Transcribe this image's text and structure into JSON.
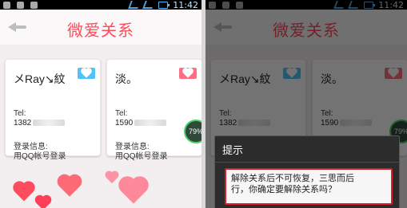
{
  "status_bar": {
    "time": "11:42"
  },
  "header": {
    "title": "微爱关系"
  },
  "cards": [
    {
      "name": "メRay↘紋",
      "tel_label": "Tel:",
      "tel_value": "1382",
      "login_label": "登录信息:",
      "login_value": "用QQ帐号登录",
      "heart_color": "#4fc3f7"
    },
    {
      "name": "淡。",
      "tel_label": "Tel:",
      "tel_value": "1590",
      "login_label": "登录信息:",
      "login_value": "用QQ帐号登录",
      "heart_color": "#ff6f81"
    }
  ],
  "progress_badge": {
    "text": "79%",
    "value": 79
  },
  "dialog": {
    "title": "提示",
    "message_line1": "解除关系后不可恢复，三思而后",
    "message_line2": "行，你确定要解除关系吗？"
  }
}
